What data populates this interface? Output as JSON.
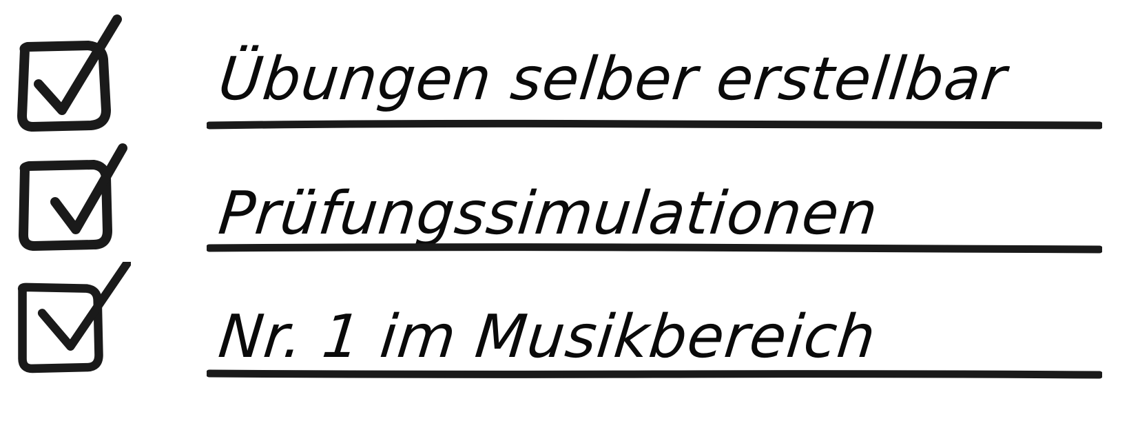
{
  "items": [
    {
      "label": "Übungen selber erstellbar",
      "checked": true
    },
    {
      "label": "Prüfungssimulationen",
      "checked": true
    },
    {
      "label": "Nr. 1 im Musikbereich",
      "checked": true
    }
  ],
  "colors": {
    "ink": "#0a0a0a",
    "background": "#ffffff"
  },
  "icons": {
    "checkbox": "checkbox-checked-icon"
  }
}
